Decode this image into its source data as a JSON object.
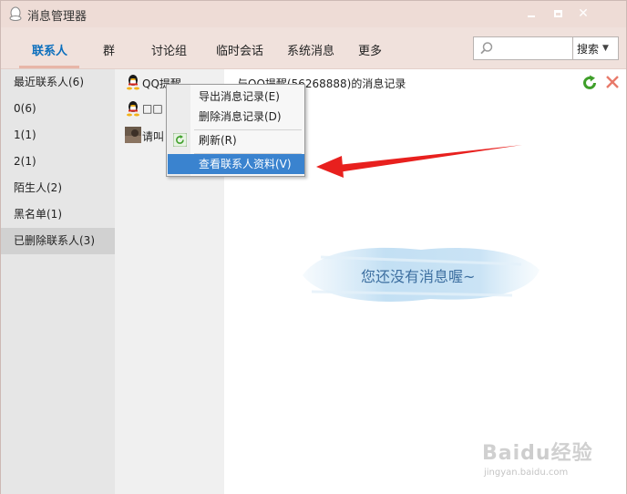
{
  "window": {
    "title": "消息管理器",
    "controls": {
      "min_icon": "minimize-icon",
      "max_icon": "maximize-icon",
      "close_icon": "close-icon",
      "close_glyph": "✕"
    }
  },
  "tabs": [
    {
      "label": "联系人",
      "active": true
    },
    {
      "label": "群",
      "active": false
    },
    {
      "label": "讨论组",
      "active": false
    },
    {
      "label": "临时会话",
      "active": false
    },
    {
      "label": "系统消息",
      "active": false
    },
    {
      "label": "更多",
      "active": false
    }
  ],
  "search": {
    "value": "",
    "placeholder": "",
    "button_label": "搜索",
    "dropdown_glyph": "▼",
    "icon": "search-icon"
  },
  "sidebar": {
    "items": [
      {
        "label": "最近联系人(6)"
      },
      {
        "label": "0(6)"
      },
      {
        "label": "1(1)"
      },
      {
        "label": "2(1)"
      },
      {
        "label": "陌生人(2)"
      },
      {
        "label": "黑名单(1)"
      },
      {
        "label": "已删除联系人(3)",
        "selected": true
      }
    ]
  },
  "contacts": [
    {
      "name": "QQ提醒",
      "avatar": "qq-penguin-icon"
    },
    {
      "name": "□□",
      "avatar": "qq-penguin-icon"
    },
    {
      "name": "请叫",
      "avatar": "photo-avatar"
    }
  ],
  "main": {
    "record_title": "与QQ提醒(56268888)的消息记录",
    "empty_message": "您还没有消息喔~",
    "refresh_icon": "refresh-icon",
    "delete_icon": "delete-icon"
  },
  "context_menu": {
    "items": [
      {
        "label": "导出消息记录(E)"
      },
      {
        "label": "删除消息记录(D)"
      },
      {
        "label": "刷新(R)",
        "icon": "refresh-icon"
      },
      {
        "label": "查看联系人资料(V)",
        "highlighted": true
      }
    ]
  },
  "watermark": {
    "brand": "Bai",
    "brand2": "经验",
    "url": "jingyan.baidu.com"
  },
  "colors": {
    "accent": "#0b6fbd",
    "highlight": "#3a83cf",
    "annotation": "#e8201e",
    "titlebar": "#eedcd6"
  }
}
